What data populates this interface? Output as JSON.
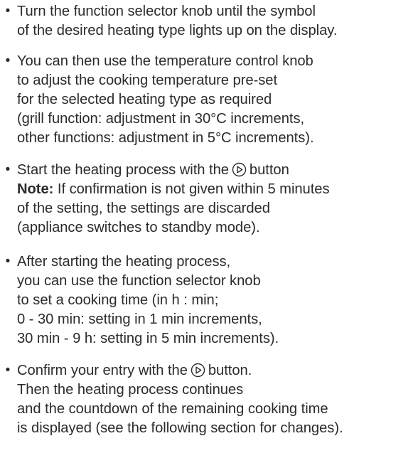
{
  "instructions": {
    "item1": {
      "lines": [
        "Turn the function selector knob until the symbol",
        "of the desired heating type lights up on the display."
      ]
    },
    "item2": {
      "lines": [
        "You can then use the temperature control knob",
        "to adjust the cooking temperature pre-set",
        "for the selected heating type as required",
        "(grill function: adjustment in 30°C increments,",
        "other functions: adjustment in 5°C increments)."
      ]
    },
    "item3": {
      "line1_before_icon": "Start the heating process with the",
      "line1_after_icon": "button",
      "note_label": "Note:",
      "note_text": " If confirmation is not given within 5 minutes",
      "lines": [
        "of the setting, the settings are discarded",
        "(appliance switches to standby mode)."
      ]
    },
    "item4": {
      "lines": [
        "After starting the heating process,",
        "you can use the function selector knob",
        "to set a cooking time (in h : min;",
        "0 - 30 min: setting in 1 min increments,",
        "30 min - 9 h: setting in 5 min increments)."
      ]
    },
    "item5": {
      "line1_before_icon": "Confirm your entry with the",
      "line1_after_icon": "button.",
      "lines": [
        "Then the heating process continues",
        "and the countdown of the remaining cooking time",
        "is displayed (see the following section for changes)."
      ]
    },
    "bullet_symbol": "•",
    "icons": {
      "start_button_icon": "play-circle-icon"
    },
    "colors": {
      "text": "#2b2b2b"
    }
  }
}
